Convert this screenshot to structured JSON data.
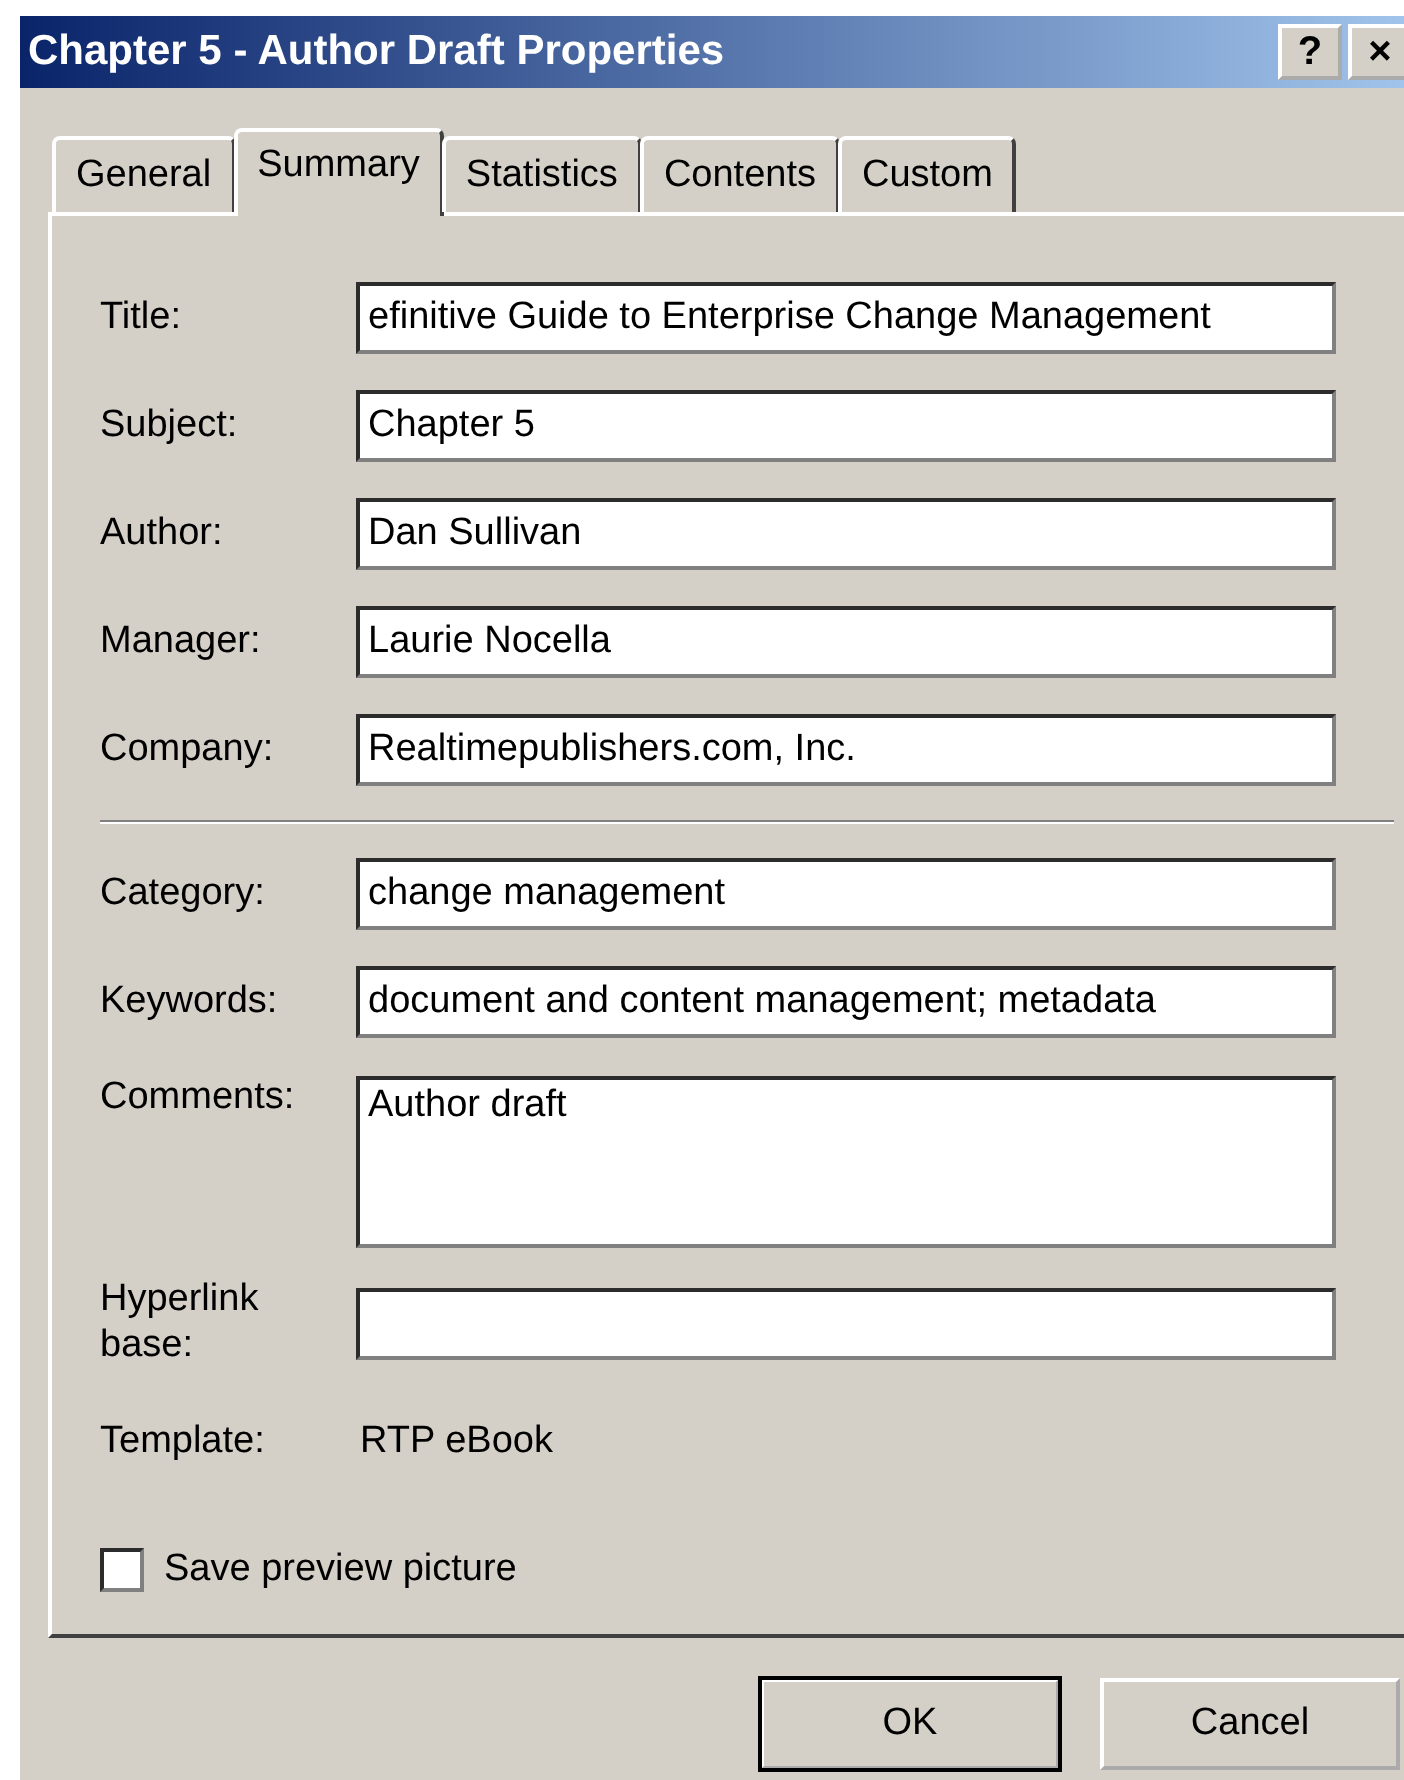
{
  "window": {
    "title": "Chapter 5 - Author Draft Properties",
    "title_buttons": [
      "?",
      "×"
    ]
  },
  "tabs": [
    {
      "label": "General",
      "selected": false
    },
    {
      "label": "Summary",
      "selected": true
    },
    {
      "label": "Statistics",
      "selected": false
    },
    {
      "label": "Contents",
      "selected": false
    },
    {
      "label": "Custom",
      "selected": false
    }
  ],
  "document_fields": [
    {
      "label": "Title:",
      "kind": "field",
      "value": "efinitive Guide to Enterprise Change Management"
    },
    {
      "label": "Subject:",
      "kind": "field",
      "value": "Chapter 5"
    },
    {
      "label": "Author:",
      "kind": "field",
      "value": "Dan Sullivan"
    },
    {
      "label": "Manager:",
      "kind": "field",
      "value": "Laurie Nocella"
    },
    {
      "label": "Company:",
      "kind": "field",
      "value": "Realtimepublishers.com, Inc."
    }
  ],
  "classification_fields": [
    {
      "label": "Category:",
      "kind": "field",
      "value": "change management"
    },
    {
      "label": "Keywords:",
      "kind": "field",
      "value": "document and content management; metadata"
    },
    {
      "label": "Comments:",
      "kind": "textarea",
      "value": "Author draft"
    },
    {
      "label": "Hyperlink base:",
      "kind": "field"
    },
    {
      "label": "Template:",
      "kind": "static",
      "value": "RTP eBook"
    }
  ],
  "save_preview_picture": {
    "label": "Save preview picture",
    "checked": false
  },
  "buttons": [
    {
      "label": "OK",
      "default": true
    },
    {
      "label": "Cancel",
      "default": false
    }
  ]
}
